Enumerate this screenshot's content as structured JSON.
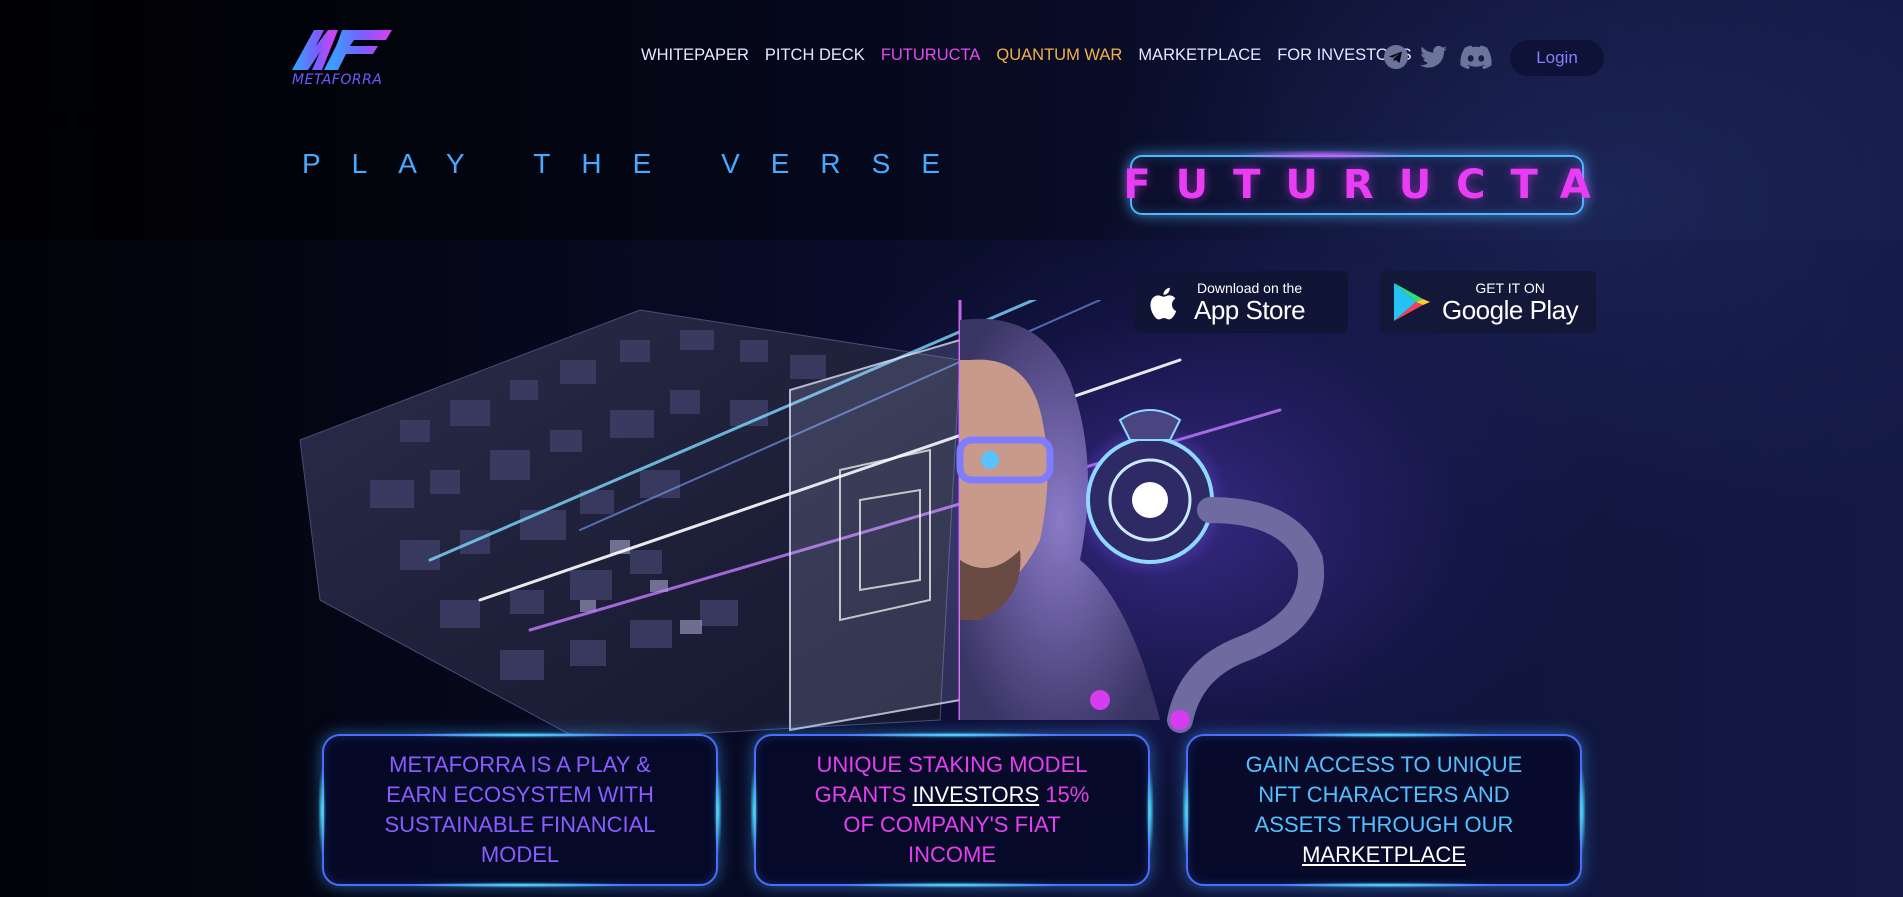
{
  "header": {
    "logo_text": "METAFORRA",
    "nav": [
      {
        "label": "WHITEPAPER"
      },
      {
        "label": "PITCH DECK"
      },
      {
        "label": "FUTURUCTA"
      },
      {
        "label": "QUANTUM WAR"
      },
      {
        "label": "MARKETPLACE"
      },
      {
        "label": "FOR INVESTORS"
      }
    ],
    "socials": [
      "telegram-icon",
      "twitter-icon",
      "discord-icon"
    ],
    "login_label": "Login"
  },
  "hero": {
    "tagline": "PLAY THE VERSE",
    "brand": "FUTURUCTA",
    "app_store": {
      "small": "Download on the",
      "big": "App Store"
    },
    "google_play": {
      "small": "GET IT ON",
      "big": "Google Play"
    }
  },
  "cards": [
    {
      "text": "METAFORRA IS A PLAY & EARN ECOSYSTEM WITH SUSTAINABLE FINANCIAL MODEL"
    },
    {
      "pre": "UNIQUE STAKING MODEL GRANTS ",
      "link": "INVESTORS",
      "post": " 15% OF COMPANY'S FIAT INCOME"
    },
    {
      "pre": "GAIN ACCESS TO UNIQUE NFT CHARACTERS AND ASSETS THROUGH OUR ",
      "link": "MARKETPLACE"
    }
  ],
  "colors": {
    "accent_pink": "#e83df5",
    "accent_blue": "#47a9ff",
    "accent_orange": "#f5b24a",
    "accent_purple": "#8a5cff",
    "background": "#05071a"
  }
}
